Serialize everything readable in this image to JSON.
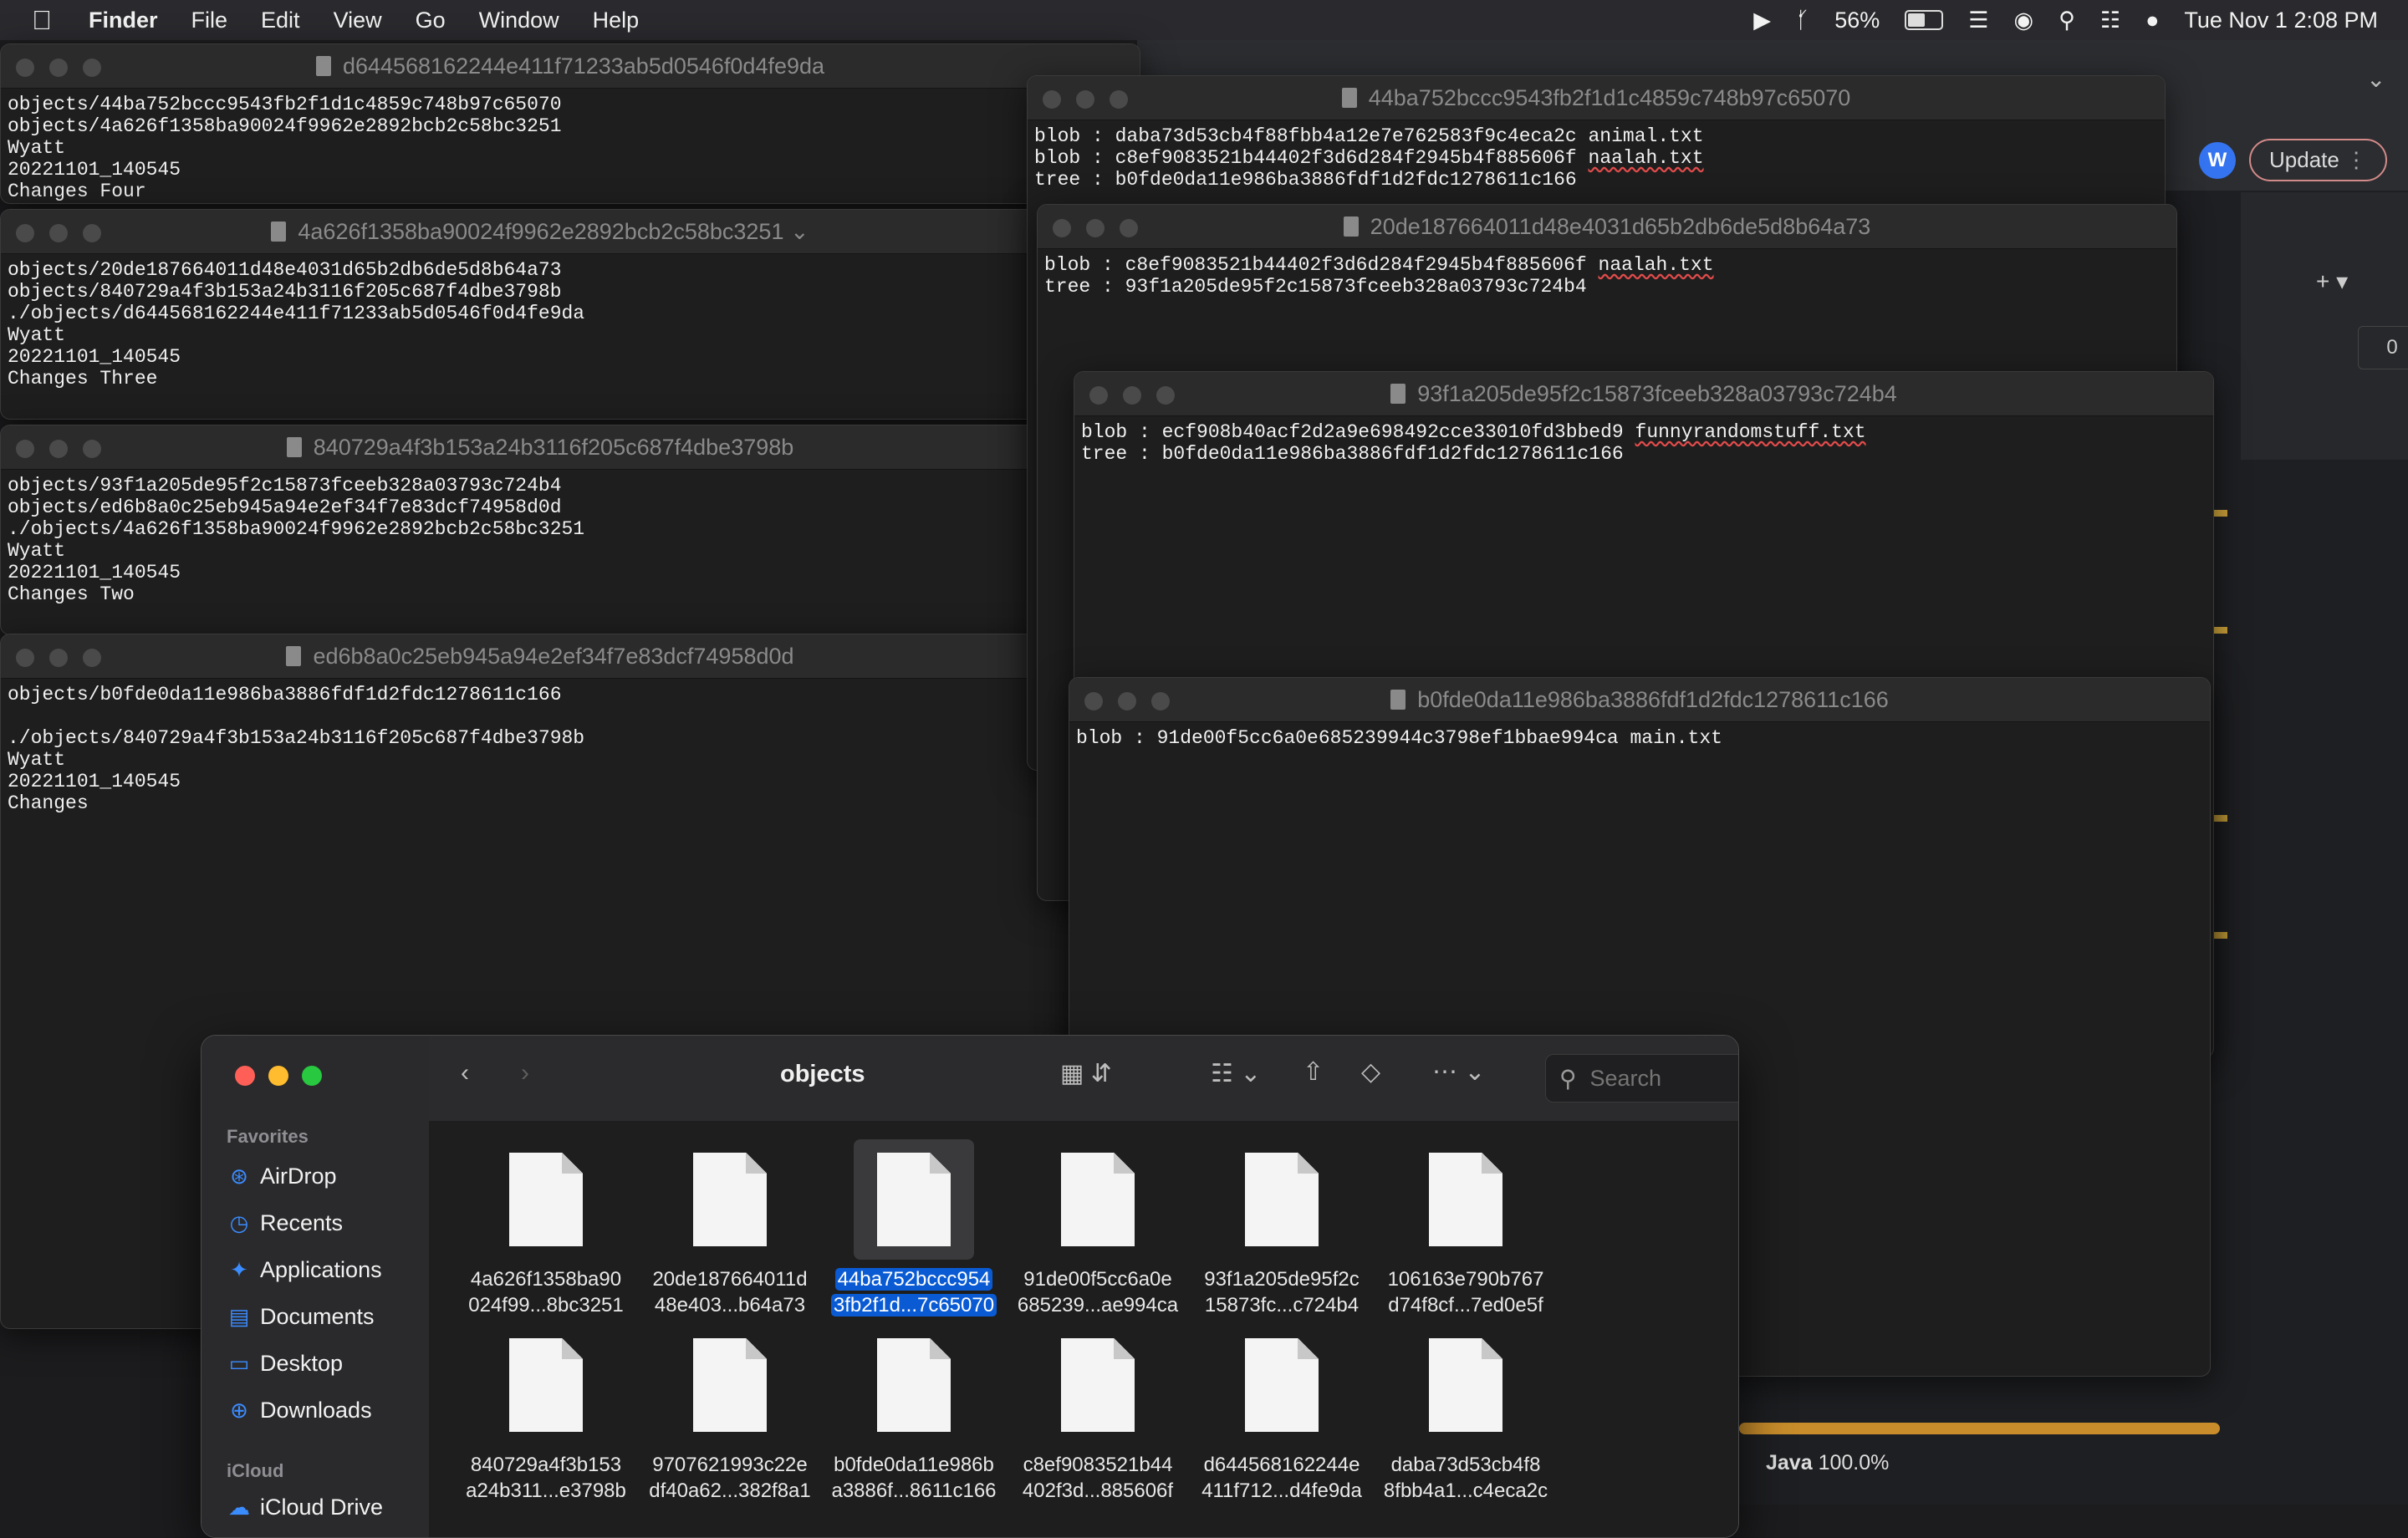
{
  "menubar": {
    "app": "Finder",
    "menus": [
      "File",
      "Edit",
      "View",
      "Go",
      "Window",
      "Help"
    ],
    "battery_percent": "56%",
    "battery_level": 0.56,
    "datetime": "Tue Nov 1  2:08 PM"
  },
  "ide": {
    "avatar_initial": "W",
    "update_label": "Update",
    "counter": "0",
    "java_label": "Java",
    "java_percent": "100.0%"
  },
  "windows": {
    "w1": {
      "title": "d644568162244e411f71233ab5d0546f0d4fe9da",
      "body": "objects/44ba752bccc9543fb2f1d1c4859c748b97c65070\nobjects/4a626f1358ba90024f9962e2892bcb2c58bc3251\nWyatt\n20221101_140545\nChanges Four"
    },
    "w2": {
      "title": "4a626f1358ba90024f9962e2892bcb2c58bc3251",
      "body": "objects/20de187664011d48e4031d65b2db6de5d8b64a73\nobjects/840729a4f3b153a24b3116f205c687f4dbe3798b\n./objects/d644568162244e411f71233ab5d0546f0d4fe9da\nWyatt\n20221101_140545\nChanges Three"
    },
    "w3": {
      "title": "840729a4f3b153a24b3116f205c687f4dbe3798b",
      "body": "objects/93f1a205de95f2c15873fceeb328a03793c724b4\nobjects/ed6b8a0c25eb945a94e2ef34f7e83dcf74958d0d\n./objects/4a626f1358ba90024f9962e2892bcb2c58bc3251\nWyatt\n20221101_140545\nChanges Two"
    },
    "w4": {
      "title": "ed6b8a0c25eb945a94e2ef34f7e83dcf74958d0d",
      "body": "objects/b0fde0da11e986ba3886fdf1d2fdc1278611c166\n\n./objects/840729a4f3b153a24b3116f205c687f4dbe3798b\nWyatt\n20221101_140545\nChanges"
    },
    "w5": {
      "title": "44ba752bccc9543fb2f1d1c4859c748b97c65070",
      "line1": "blob : daba73d53cb4f88fbb4a12e7e762583f9c4eca2c animal.txt",
      "line2_prefix": "blob : c8ef9083521b44402f3d6d284f2945b4f885606f ",
      "line2_file": "naalah.txt",
      "line3": "tree : b0fde0da11e986ba3886fdf1d2fdc1278611c166"
    },
    "w6": {
      "title": "20de187664011d48e4031d65b2db6de5d8b64a73",
      "line1_prefix": "blob : c8ef9083521b44402f3d6d284f2945b4f885606f ",
      "line1_file": "naalah.txt",
      "line2": "tree : 93f1a205de95f2c15873fceeb328a03793c724b4"
    },
    "w7": {
      "title": "93f1a205de95f2c15873fceeb328a03793c724b4",
      "line1_prefix": "blob : ecf908b40acf2d2a9e698492cce33010fd3bbed9 ",
      "line1_file": "funnyrandomstuff.txt",
      "line2": "tree : b0fde0da11e986ba3886fdf1d2fdc1278611c166"
    },
    "w8": {
      "title": "b0fde0da11e986ba3886fdf1d2fdc1278611c166",
      "body": "blob : 91de00f5cc6a0e685239944c3798ef1bbae994ca main.txt"
    }
  },
  "finder": {
    "title": "objects",
    "search_placeholder": "Search",
    "sidebar": {
      "favorites_label": "Favorites",
      "items": [
        "AirDrop",
        "Recents",
        "Applications",
        "Documents",
        "Desktop",
        "Downloads"
      ],
      "icons": [
        "airdrop-icon",
        "clock-icon",
        "applications-icon",
        "document-icon",
        "desktop-icon",
        "downloads-icon"
      ],
      "icloud_label": "iCloud",
      "icloud_item": "iCloud Drive"
    },
    "files": [
      {
        "l1": "4a626f1358ba90",
        "l2": "024f99...8bc3251"
      },
      {
        "l1": "20de187664011d",
        "l2": "48e403...b64a73"
      },
      {
        "l1": "44ba752bccc954",
        "l2": "3fb2f1d...7c65070"
      },
      {
        "l1": "91de00f5cc6a0e",
        "l2": "685239...ae994ca"
      },
      {
        "l1": "93f1a205de95f2c",
        "l2": "15873fc...c724b4"
      },
      {
        "l1": "106163e790b767",
        "l2": "d74f8cf...7ed0e5f"
      },
      {
        "l1": "840729a4f3b153",
        "l2": "a24b311...e3798b"
      },
      {
        "l1": "9707621993c22e",
        "l2": "df40a62...382f8a1"
      },
      {
        "l1": "b0fde0da11e986b",
        "l2": "a3886f...8611c166"
      },
      {
        "l1": "c8ef9083521b44",
        "l2": "402f3d...885606f"
      },
      {
        "l1": "d644568162244e",
        "l2": "411f712...d4fe9da"
      },
      {
        "l1": "daba73d53cb4f8",
        "l2": "8fbb4a1...c4eca2c"
      }
    ],
    "selected_index": 2
  }
}
